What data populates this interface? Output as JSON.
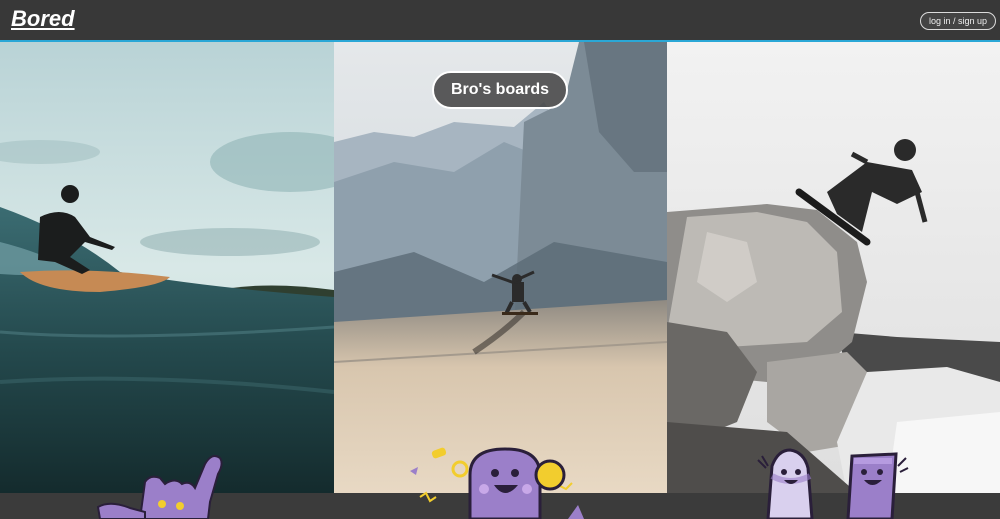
{
  "header": {
    "brand": "Bored",
    "login_label": "log in / sign up"
  },
  "hero": {
    "title": "Bro's boards"
  },
  "panels": [
    {
      "name": "surfing-photo",
      "icon": "surfer-image"
    },
    {
      "name": "skateboarding-photo",
      "icon": "skateboarder-image"
    },
    {
      "name": "snowboarding-photo",
      "icon": "snowboarder-image"
    }
  ],
  "colors": {
    "nav_bg": "#383838",
    "nav_accent": "#2aa7d6",
    "mascot_purple": "#9b7fc9",
    "mascot_yellow": "#f2cd2e"
  }
}
